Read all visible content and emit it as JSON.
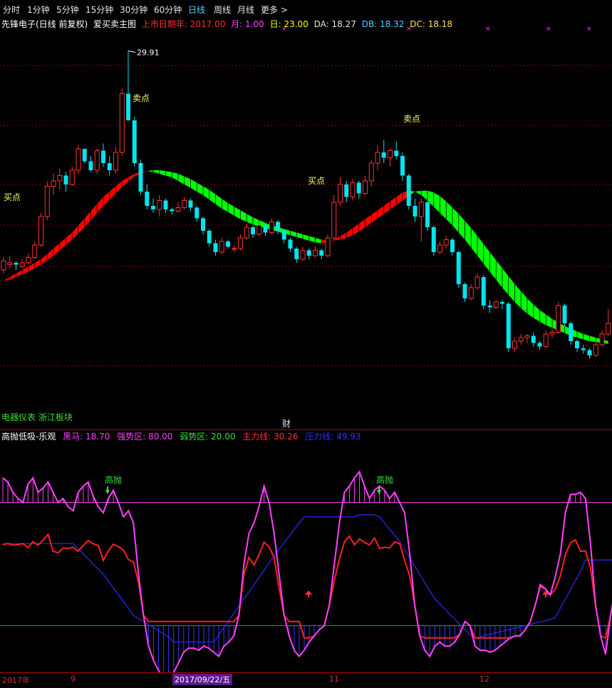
{
  "tabs": [
    "分时",
    "1分钟",
    "5分钟",
    "15分钟",
    "30分钟",
    "60分钟",
    "日线",
    "周线",
    "月线",
    "更多 >"
  ],
  "active_tab": 6,
  "header": {
    "stock": "先锋电子(日线 前复权)",
    "indicator": "爱买卖主图",
    "ipo_label": "上市日期年: 2017.00",
    "month_label": "月: 1.00",
    "day_label": "日: 23.00",
    "da_label": "DA: 18.27",
    "db_label": "DB: 18.32",
    "dc_label": "DC: 18.18"
  },
  "main_chart": {
    "high_marker": "29.91",
    "signals": {
      "buy1": "买点",
      "sell1": "卖点",
      "buy2": "买点",
      "sell2": "卖点"
    }
  },
  "block_label": "电器仪表 浙江板块",
  "cai_label": "财",
  "sub_header": {
    "name": "高抛低吸-乐观",
    "heima": "黑马: 18.70",
    "strong": "强势区: 80.00",
    "weak": "弱势区: 20.00",
    "main_line": "主力线: 30.26",
    "press_line": "压力线: 49.93"
  },
  "sub_signals": {
    "high1": "高抛",
    "high2": "高抛"
  },
  "date_axis": {
    "year": "2017年",
    "m9": "9",
    "selected": "2017/09/22/五",
    "m11": "11",
    "m12": "12"
  },
  "colors": {
    "up": "#ff3232",
    "down": "#00e5ee",
    "ribbon_up": "#ff0000",
    "ribbon_down": "#00ff00",
    "magenta": "#ff40ff",
    "blue": "#2222ff",
    "red": "#ff2020",
    "green": "#00c800"
  },
  "chart_data": [
    {
      "type": "candlestick",
      "candles": [
        [
          17.6,
          18.3,
          17.4,
          18.1
        ],
        [
          17.9,
          18.4,
          17.7,
          18.0
        ],
        [
          18.0,
          18.1,
          17.6,
          17.9
        ],
        [
          17.8,
          18.2,
          17.7,
          18.0
        ],
        [
          18.0,
          18.5,
          17.9,
          18.3
        ],
        [
          18.3,
          19.2,
          18.2,
          19.0
        ],
        [
          19.0,
          20.8,
          18.9,
          20.6
        ],
        [
          20.6,
          22.6,
          20.4,
          22.3
        ],
        [
          22.3,
          23.0,
          21.8,
          22.6
        ],
        [
          22.6,
          23.3,
          22.1,
          22.9
        ],
        [
          22.9,
          23.1,
          22.0,
          22.4
        ],
        [
          22.4,
          23.4,
          22.3,
          23.2
        ],
        [
          23.2,
          24.6,
          23.0,
          24.4
        ],
        [
          24.4,
          24.3,
          23.6,
          23.7
        ],
        [
          23.7,
          24.0,
          23.1,
          23.2
        ],
        [
          23.2,
          24.4,
          23.0,
          24.3
        ],
        [
          24.3,
          24.7,
          23.4,
          23.6
        ],
        [
          23.6,
          24.0,
          22.9,
          23.2
        ],
        [
          23.2,
          24.5,
          23.0,
          24.2
        ],
        [
          24.2,
          27.8,
          24.0,
          27.5
        ],
        [
          27.5,
          29.9,
          26.0,
          26.0
        ],
        [
          26.0,
          26.2,
          23.4,
          23.6
        ],
        [
          23.6,
          23.8,
          21.8,
          22.0
        ],
        [
          22.0,
          22.4,
          21.0,
          21.2
        ],
        [
          21.2,
          21.6,
          20.8,
          21.0
        ],
        [
          21.0,
          21.8,
          20.6,
          21.5
        ],
        [
          21.5,
          21.6,
          20.8,
          21.0
        ],
        [
          21.0,
          21.1,
          20.7,
          20.9
        ],
        [
          20.9,
          21.4,
          20.8,
          21.1
        ],
        [
          21.1,
          21.7,
          21.0,
          21.5
        ],
        [
          21.5,
          21.6,
          20.9,
          21.1
        ],
        [
          21.1,
          21.2,
          20.3,
          20.5
        ],
        [
          20.5,
          20.6,
          19.6,
          19.8
        ],
        [
          19.8,
          19.9,
          18.9,
          19.1
        ],
        [
          19.1,
          19.3,
          18.4,
          18.6
        ],
        [
          18.6,
          19.4,
          18.5,
          19.2
        ],
        [
          19.2,
          19.3,
          18.8,
          18.9
        ],
        [
          18.8,
          19.0,
          18.6,
          18.8
        ],
        [
          18.8,
          19.6,
          18.7,
          19.4
        ],
        [
          19.4,
          20.2,
          19.3,
          20.0
        ],
        [
          20.0,
          20.1,
          19.4,
          19.6
        ],
        [
          19.6,
          20.3,
          19.5,
          20.1
        ],
        [
          20.1,
          20.2,
          19.5,
          19.7
        ],
        [
          19.7,
          20.5,
          19.6,
          20.3
        ],
        [
          20.3,
          20.4,
          19.6,
          19.8
        ],
        [
          19.8,
          19.9,
          19.1,
          19.3
        ],
        [
          19.3,
          19.4,
          18.6,
          18.8
        ],
        [
          18.8,
          18.9,
          18.0,
          18.2
        ],
        [
          18.2,
          18.9,
          18.1,
          18.7
        ],
        [
          18.7,
          18.8,
          18.2,
          18.4
        ],
        [
          18.4,
          18.9,
          18.3,
          18.7
        ],
        [
          18.7,
          18.8,
          18.2,
          18.4
        ],
        [
          18.4,
          19.6,
          18.3,
          19.4
        ],
        [
          19.4,
          21.8,
          19.3,
          21.4
        ],
        [
          21.4,
          22.8,
          21.2,
          22.4
        ],
        [
          22.4,
          22.6,
          21.4,
          21.7
        ],
        [
          21.7,
          22.7,
          21.5,
          22.5
        ],
        [
          22.5,
          22.6,
          21.6,
          21.9
        ],
        [
          21.9,
          22.9,
          21.8,
          22.6
        ],
        [
          22.6,
          23.8,
          22.3,
          23.6
        ],
        [
          23.6,
          24.6,
          23.2,
          24.2
        ],
        [
          24.2,
          24.9,
          23.6,
          23.9
        ],
        [
          23.9,
          24.4,
          23.4,
          24.3
        ],
        [
          24.3,
          24.8,
          23.8,
          24.0
        ],
        [
          24.0,
          24.2,
          22.6,
          22.9
        ],
        [
          22.9,
          23.0,
          21.0,
          21.2
        ],
        [
          21.2,
          21.6,
          20.3,
          20.6
        ],
        [
          20.6,
          21.6,
          19.2,
          21.4
        ],
        [
          21.4,
          21.5,
          19.8,
          20.0
        ],
        [
          20.0,
          20.1,
          18.4,
          18.6
        ],
        [
          18.6,
          19.2,
          18.5,
          19.0
        ],
        [
          19.0,
          19.5,
          18.8,
          19.3
        ],
        [
          19.3,
          19.4,
          18.4,
          18.6
        ],
        [
          18.6,
          18.7,
          16.6,
          16.8
        ],
        [
          16.8,
          16.9,
          15.8,
          16.0
        ],
        [
          16.0,
          16.8,
          15.9,
          16.6
        ],
        [
          16.6,
          17.4,
          16.5,
          17.2
        ],
        [
          17.2,
          17.3,
          15.4,
          15.6
        ],
        [
          15.6,
          15.9,
          15.2,
          15.5
        ],
        [
          15.5,
          15.9,
          15.4,
          15.8
        ],
        [
          15.8,
          15.9,
          15.4,
          15.7
        ],
        [
          15.7,
          15.8,
          13.0,
          13.2
        ],
        [
          13.2,
          13.8,
          13.0,
          13.6
        ],
        [
          13.6,
          14.0,
          13.4,
          13.8
        ],
        [
          13.8,
          14.0,
          13.5,
          13.9
        ],
        [
          13.9,
          14.1,
          13.3,
          13.5
        ],
        [
          13.5,
          13.6,
          13.1,
          13.3
        ],
        [
          13.3,
          14.2,
          13.2,
          14.0
        ],
        [
          14.0,
          14.3,
          13.8,
          14.1
        ],
        [
          14.1,
          15.8,
          14.0,
          15.6
        ],
        [
          15.6,
          15.7,
          14.4,
          14.6
        ],
        [
          14.6,
          14.7,
          13.4,
          13.6
        ],
        [
          13.6,
          13.7,
          13.0,
          13.2
        ],
        [
          13.2,
          13.4,
          12.9,
          13.1
        ],
        [
          13.1,
          13.2,
          12.6,
          12.8
        ],
        [
          12.8,
          13.6,
          12.7,
          13.4
        ],
        [
          13.4,
          14.2,
          13.3,
          14.0
        ],
        [
          14.0,
          15.4,
          13.9,
          14.6
        ]
      ],
      "ribbon_a": [
        17.0,
        17.2,
        17.4,
        17.6,
        17.8,
        18.0,
        18.2,
        18.5,
        18.8,
        19.1,
        19.4,
        19.7,
        20.1,
        20.5,
        20.9,
        21.3,
        21.7,
        22.0,
        22.3,
        22.6,
        22.8,
        23.0,
        23.1,
        23.15,
        23.1,
        23.0,
        22.9,
        22.8,
        22.6,
        22.4,
        22.2,
        22.0,
        21.8,
        21.55,
        21.3,
        21.05,
        20.85,
        20.65,
        20.45,
        20.3,
        20.15,
        20.05,
        19.95,
        19.85,
        19.75,
        19.65,
        19.55,
        19.45,
        19.35,
        19.25,
        19.15,
        19.1,
        19.15,
        19.3,
        19.5,
        19.7,
        19.95,
        20.2,
        20.45,
        20.7,
        20.95,
        21.2,
        21.45,
        21.7,
        21.95,
        22.05,
        22.0,
        21.8,
        21.5,
        21.15,
        20.8,
        20.45,
        20.1,
        19.7,
        19.3,
        18.85,
        18.4,
        17.95,
        17.5,
        17.05,
        16.6,
        16.2,
        15.8,
        15.45,
        15.15,
        14.9,
        14.7,
        14.5,
        14.35,
        14.2,
        14.05,
        13.9,
        13.8,
        13.7,
        13.6,
        13.55,
        13.5,
        13.45
      ],
      "ribbon_b": [
        17.0,
        17.05,
        17.2,
        17.35,
        17.5,
        17.7,
        17.9,
        18.15,
        18.4,
        18.7,
        19.0,
        19.3,
        19.65,
        20.0,
        20.4,
        20.8,
        21.2,
        21.55,
        21.9,
        22.25,
        22.55,
        22.85,
        23.0,
        23.15,
        23.2,
        23.2,
        23.15,
        23.1,
        23.0,
        22.85,
        22.7,
        22.5,
        22.3,
        22.1,
        21.85,
        21.6,
        21.35,
        21.15,
        20.95,
        20.75,
        20.55,
        20.4,
        20.25,
        20.1,
        20.0,
        19.9,
        19.8,
        19.7,
        19.6,
        19.5,
        19.4,
        19.3,
        19.25,
        19.25,
        19.3,
        19.4,
        19.55,
        19.75,
        20.0,
        20.25,
        20.5,
        20.75,
        21.0,
        21.25,
        21.5,
        21.75,
        22.0,
        22.05,
        22.05,
        21.95,
        21.75,
        21.45,
        21.1,
        20.75,
        20.35,
        19.95,
        19.5,
        19.05,
        18.6,
        18.15,
        17.7,
        17.25,
        16.8,
        16.4,
        16.0,
        15.65,
        15.35,
        15.1,
        14.85,
        14.65,
        14.45,
        14.3,
        14.15,
        14.0,
        13.9,
        13.8,
        13.7,
        13.6
      ],
      "ylim": [
        8.6,
        31.8
      ]
    },
    {
      "type": "line",
      "ylim": [
        0,
        100
      ],
      "strong": 80,
      "weak": 20,
      "heima": [
        92,
        90,
        85,
        82,
        80,
        89,
        92,
        85,
        87,
        90,
        85,
        80,
        82,
        78,
        76,
        85,
        88,
        90,
        83,
        78,
        75,
        82,
        86,
        80,
        73,
        76,
        70,
        45,
        25,
        10,
        3,
        -2,
        -5,
        -5,
        -3,
        2,
        7,
        9,
        9,
        8,
        10,
        9,
        7,
        5,
        10,
        12,
        15,
        25,
        50,
        65,
        70,
        78,
        88,
        80,
        65,
        45,
        25,
        15,
        8,
        5,
        8,
        12,
        15,
        18,
        20,
        30,
        50,
        70,
        85,
        88,
        92,
        95,
        88,
        82,
        86,
        88,
        86,
        82,
        85,
        80,
        75,
        55,
        30,
        15,
        8,
        5,
        10,
        12,
        10,
        10,
        12,
        16,
        22,
        20,
        10,
        8,
        8,
        7,
        8,
        10,
        12,
        14,
        15,
        15,
        18,
        22,
        30,
        40,
        38,
        35,
        44,
        55,
        75,
        84,
        84,
        85,
        82,
        60,
        30,
        15,
        6,
        25,
        40,
        45
      ]
    }
  ]
}
